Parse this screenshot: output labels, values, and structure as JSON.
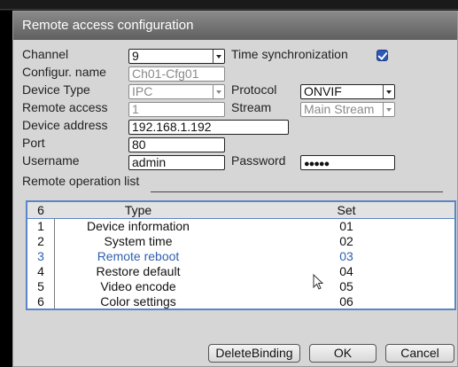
{
  "dialog": {
    "title": "Remote access configuration"
  },
  "form": {
    "channel_label": "Channel",
    "channel_value": "9",
    "time_sync_label": "Time synchronization",
    "time_sync_checked": true,
    "config_name_label": "Configur. name",
    "config_name_value": "Ch01-Cfg01",
    "device_type_label": "Device Type",
    "device_type_value": "IPC",
    "protocol_label": "Protocol",
    "protocol_value": "ONVIF",
    "remote_access_label": "Remote access",
    "remote_access_value": "1",
    "stream_label": "Stream",
    "stream_value": "Main Stream",
    "device_address_label": "Device address",
    "device_address_value": "192.168.1.192",
    "port_label": "Port",
    "port_value": "80",
    "username_label": "Username",
    "username_value": "admin",
    "password_label": "Password",
    "password_value": "●●●●●"
  },
  "operation_list": {
    "section_label": "Remote operation list",
    "header_count": "6",
    "header_type": "Type",
    "header_set": "Set",
    "rows": [
      {
        "idx": "1",
        "type": "Device information",
        "set": "01"
      },
      {
        "idx": "2",
        "type": "System time",
        "set": "02"
      },
      {
        "idx": "3",
        "type": "Remote reboot",
        "set": "03"
      },
      {
        "idx": "4",
        "type": "Restore default",
        "set": "04"
      },
      {
        "idx": "5",
        "type": "Video encode",
        "set": "05"
      },
      {
        "idx": "6",
        "type": "Color settings",
        "set": "06"
      }
    ],
    "selected_row": 3
  },
  "buttons": {
    "delete_binding": "DeleteBinding",
    "ok": "OK",
    "cancel": "Cancel"
  },
  "icons": {
    "dropdown": "chevron-down-icon",
    "checkbox": "checkbox-checked-icon",
    "cursor": "mouse-pointer-icon"
  },
  "colors": {
    "accent": "#2d57b8",
    "selected_text": "#2f5fb0",
    "table_border": "#5a86c8"
  }
}
